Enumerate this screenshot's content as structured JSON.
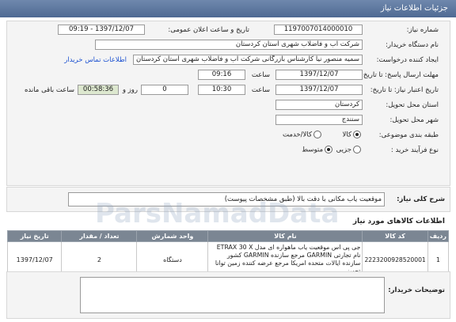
{
  "header": {
    "title": "جزئیات اطلاعات نیاز"
  },
  "form": {
    "need_number_label": "شماره نیاز:",
    "need_number": "1197007014000010",
    "announce_label": "تاریخ و ساعت اعلان عمومی:",
    "announce_value": "1397/12/07 - 09:19",
    "buyer_label": "نام دستگاه خریدار:",
    "buyer_value": "شرکت آب و فاضلاب شهری استان کردستان",
    "creator_label": "ایجاد کننده درخواست:",
    "creator_value": "سمیه منصور نیا کارشناس بازرگانی شرکت آب و فاضلاب شهری استان کردستان",
    "contact_link": "اطلاعات تماس خریدار",
    "deadline_label": "مهلت ارسال پاسخ: تا تاریخ:",
    "deadline_date": "1397/12/07",
    "time_label": "ساعت",
    "deadline_time": "09:16",
    "validity_label": "تاریخ اعتبار نیاز: تا تاریخ:",
    "validity_date": "1397/12/07",
    "validity_time": "10:30",
    "days_value": "0",
    "days_label": "روز و",
    "timer_value": "00:58:36",
    "remaining_label": "ساعت باقی مانده",
    "province_label": "استان محل تحویل:",
    "province_value": "کردستان",
    "city_label": "شهر محل تحویل:",
    "city_value": "سنندج",
    "category_label": "طبقه بندی موضوعی:",
    "category_goods": "کالا",
    "category_service": "کالا/خدمت",
    "process_label": "نوع فرآیند خرید :",
    "process_minor": "جزیی",
    "process_medium": "متوسط"
  },
  "summary": {
    "label": "شرح کلی نیاز:",
    "value": "موقعیت یاب مکانی با دقت بالا (طبق مشخصات پیوست)"
  },
  "goods": {
    "title": "اطلاعات کالاهای مورد نیاز",
    "columns": [
      "ردیف",
      "کد کالا",
      "نام کالا",
      "واحد شمارش",
      "تعداد / مقدار",
      "تاریخ نیاز"
    ],
    "rows": [
      {
        "index": "1",
        "code": "2223200928520001",
        "name": "جی پی اس موقعیت یاب ماهواره ای مدل ETRAX 30 X نام تجارتی GARMIN مرجع سازنده GARMIN کشور سازنده ایالات متحده امریکا مرجع عرضه کننده زمین توانا تجهیز",
        "unit": "دستگاه",
        "qty": "2",
        "date": "1397/12/07"
      }
    ]
  },
  "buyer_notes": {
    "label": "توضیحات خریدار:",
    "value": ""
  },
  "watermark": "ParsNamadData"
}
